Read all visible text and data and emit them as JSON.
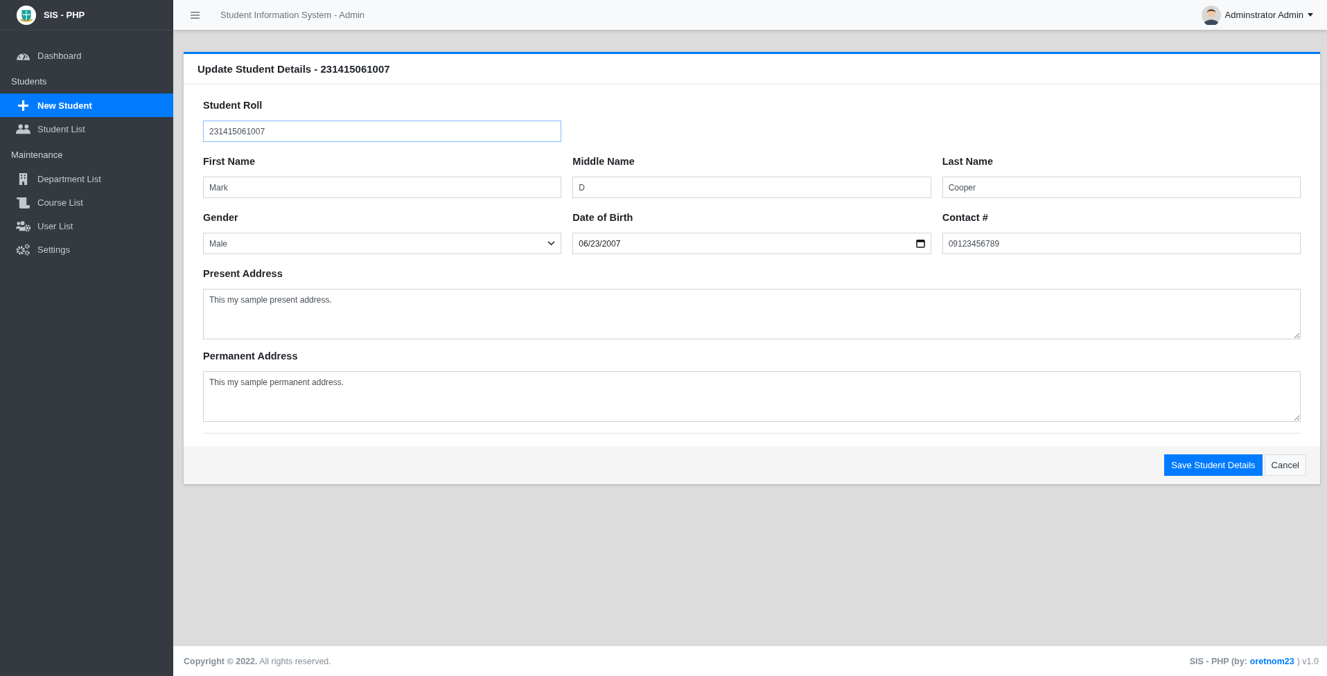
{
  "brand": {
    "title": "SIS - PHP"
  },
  "sidebar": {
    "sections": [
      {
        "items": [
          {
            "label": "Dashboard",
            "kind": "gauge",
            "selected": false
          }
        ]
      },
      {
        "heading": "Students",
        "items": [
          {
            "label": "New Student",
            "kind": "plus",
            "selected": true
          },
          {
            "label": "Student List",
            "kind": "users",
            "selected": false
          }
        ]
      },
      {
        "heading": "Maintenance",
        "items": [
          {
            "label": "Department List",
            "kind": "building",
            "selected": false
          },
          {
            "label": "Course List",
            "kind": "scroll",
            "selected": false
          },
          {
            "label": "User List",
            "kind": "users-gear",
            "selected": false
          },
          {
            "label": "Settings",
            "kind": "gears",
            "selected": false
          }
        ]
      }
    ]
  },
  "header": {
    "title": "Student Information System - Admin",
    "user": "Adminstrator Admin"
  },
  "card": {
    "title": "Update Student Details - 231415061007",
    "rows": [
      [
        {
          "kind": "text",
          "label": "Student Roll",
          "value": "231415061007",
          "focused": true
        }
      ],
      [
        {
          "kind": "text",
          "label": "First Name",
          "value": "Mark",
          "focused": false
        },
        {
          "kind": "text",
          "label": "Middle Name",
          "value": "D",
          "focused": false
        },
        {
          "kind": "text",
          "label": "Last Name",
          "value": "Cooper",
          "focused": false
        }
      ],
      [
        {
          "kind": "select",
          "label": "Gender",
          "value": "Male",
          "focused": false
        },
        {
          "kind": "date",
          "label": "Date of Birth",
          "value": "06/23/2007",
          "focused": false
        },
        {
          "kind": "text",
          "label": "Contact #",
          "value": "09123456789",
          "focused": false
        }
      ],
      [
        {
          "kind": "textarea",
          "label": "Present Address",
          "value": "This my sample present address.",
          "focused": false
        }
      ],
      [
        {
          "kind": "textarea",
          "label": "Permanent Address",
          "value": "This my sample permanent address.",
          "focused": false
        }
      ]
    ],
    "buttons": [
      {
        "label": "Save Student Details",
        "kind": "primary"
      },
      {
        "label": "Cancel",
        "kind": "secondary"
      }
    ]
  },
  "footer": {
    "copyright": "**Copyright © 2022.** All rights reserved.",
    "credit_prefix": "SIS - PHP (by:",
    "credit_link": "oretnom23",
    "credit_suffix": ") v1.0"
  }
}
